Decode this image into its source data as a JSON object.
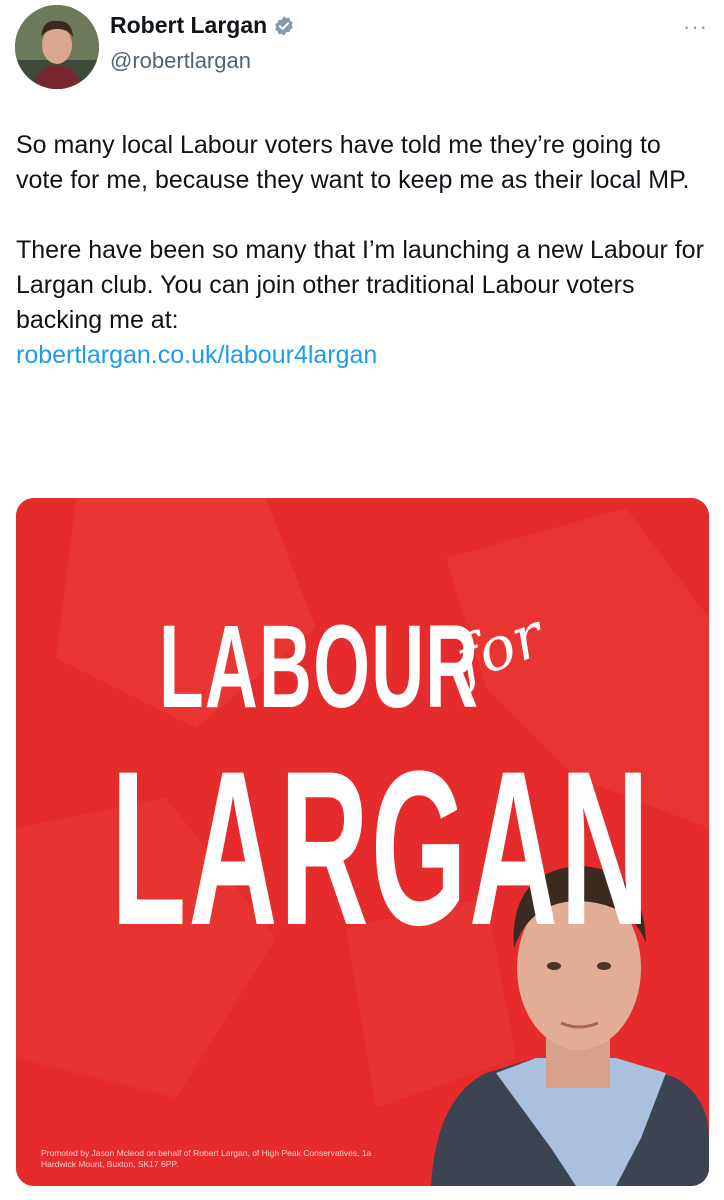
{
  "author": {
    "display_name": "Robert Largan",
    "handle": "@robertlargan",
    "verified": "verified-badge-icon"
  },
  "more_menu": "···",
  "tweet": {
    "paragraph1": "So many local Labour voters have told me they’re going to vote for me, because they want to keep me as their local MP.",
    "paragraph2": "There have been so many that I’m launching a new Labour for Largan club. You can join other traditional Labour voters backing me at:",
    "link": "robertlargan.co.uk/labour4largan"
  },
  "media": {
    "word_labour": "LABOUR",
    "word_for": "for",
    "word_largan": "LARGAN",
    "promoted_text": "Promoted by Jason Mcleod on behalf of Robert Largan, of High Peak Conservatives, 1a Hardwick Mount, Buxton, SK17 6PP.",
    "background_color": "#e52b2b"
  },
  "colors": {
    "link": "#1d9bf0",
    "verified": "#829aab",
    "text": "#0f1419",
    "secondary": "#536471"
  }
}
